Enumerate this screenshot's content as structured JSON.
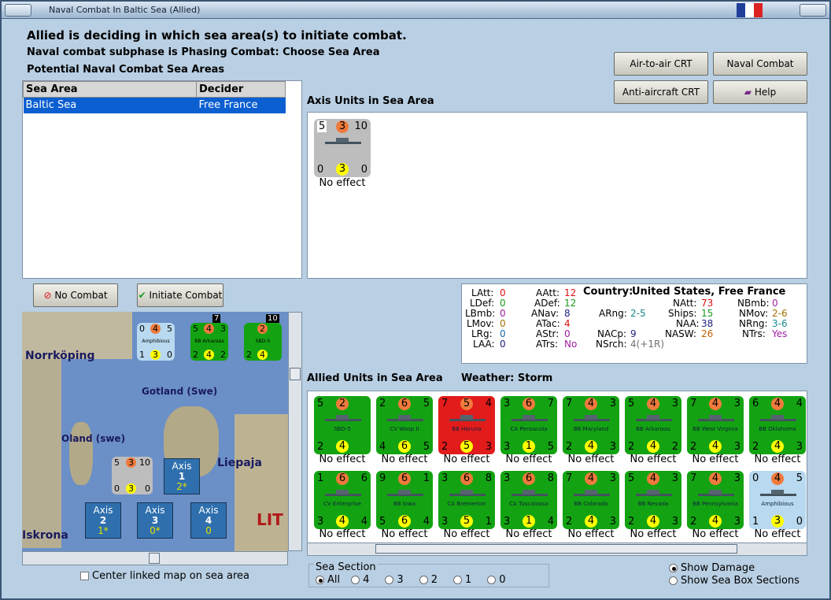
{
  "window": {
    "title": "Naval Combat In Baltic Sea (Allied)"
  },
  "header": {
    "line1": "Allied is deciding in which sea area(s) to initiate combat.",
    "line2": "Naval combat subphase is Phasing Combat: Choose Sea Area",
    "line3": "Potential Naval Combat Sea Areas"
  },
  "buttons": {
    "air_to_air": "Air-to-air CRT",
    "naval_chart": "Naval Combat Chart",
    "anti_aircraft": "Anti-aircraft CRT",
    "help": "Help",
    "no_combat": "No Combat",
    "initiate": "Initiate Combat"
  },
  "sea_table": {
    "headers": [
      "Sea Area",
      "Decider"
    ],
    "rows": [
      [
        "Baltic Sea",
        "Free France"
      ]
    ]
  },
  "axis_panel": {
    "title": "Axis Units in Sea Area",
    "unit": {
      "tl": "5",
      "tc": "3",
      "tr": "10",
      "bl": "0",
      "bc": "3",
      "br": "0",
      "effect": "No effect"
    }
  },
  "stats": {
    "latt_l": "LAtt:",
    "latt_v": "0",
    "ldef_l": "LDef:",
    "ldef_v": "0",
    "lbmb_l": "LBmb:",
    "lbmb_v": "0",
    "lmov_l": "LMov:",
    "lmov_v": "0",
    "lrg_l": "LRg:",
    "lrg_v": "0",
    "laa_l": "LAA:",
    "laa_v": "0",
    "aatt_l": "AAtt:",
    "aatt_v": "12",
    "adef_l": "ADef:",
    "adef_v": "12",
    "anav_l": "ANav:",
    "anav_v": "8",
    "atac_l": "ATac:",
    "atac_v": "4",
    "astr_l": "AStr:",
    "astr_v": "0",
    "atrs_l": "ATrs:",
    "atrs_v": "No",
    "country_l": "Country:",
    "country_v": "United States, Free France",
    "arng_l": "ARng:",
    "arng_v": "2-5",
    "nacp_l": "NACp:",
    "nacp_v": "9",
    "nsrch_l": "NSrch:",
    "nsrch_v": "4(+1R)",
    "natt_l": "NAtt:",
    "natt_v": "73",
    "ships_l": "Ships:",
    "ships_v": "15",
    "naa_l": "NAA:",
    "naa_v": "38",
    "nasw_l": "NASW:",
    "nasw_v": "26",
    "nbmb_l": "NBmb:",
    "nbmb_v": "0",
    "nmov_l": "NMov:",
    "nmov_v": "2-6",
    "nrng_l": "NRng:",
    "nrng_v": "3-6",
    "ntrs_l": "NTrs:",
    "ntrs_v": "Yes"
  },
  "allied_panel": {
    "title": "Allied Units in Sea Area",
    "weather": "Weather:  Storm",
    "units": [
      {
        "name": "SBD-5",
        "tl": "5",
        "tc": "2",
        "tr": "",
        "bl": "2",
        "bc": "4",
        "br": "",
        "color": "#13a312",
        "effect": "No effect"
      },
      {
        "name": "CV Wasp II",
        "tl": "2",
        "tc": "6",
        "tr": "5",
        "bl": "4",
        "bc": "6",
        "br": "5",
        "color": "#13a312",
        "effect": "No effect"
      },
      {
        "name": "BB Haruna",
        "tl": "7",
        "tc": "5",
        "tr": "4",
        "bl": "2",
        "bc": "5",
        "br": "3",
        "color": "#e21b1b",
        "effect": "No effect"
      },
      {
        "name": "CA Pensacola",
        "tl": "3",
        "tc": "6",
        "tr": "7",
        "bl": "3",
        "bc": "1",
        "br": "5",
        "color": "#13a312",
        "effect": "No effect"
      },
      {
        "name": "BB Maryland",
        "tl": "7",
        "tc": "4",
        "tr": "3",
        "bl": "2",
        "bc": "4",
        "br": "3",
        "color": "#13a312",
        "effect": "No effect"
      },
      {
        "name": "BB Arkansas",
        "tl": "5",
        "tc": "4",
        "tr": "3",
        "bl": "2",
        "bc": "4",
        "br": "2",
        "color": "#13a312",
        "effect": "No effect"
      },
      {
        "name": "BB West Virginia",
        "tl": "7",
        "tc": "4",
        "tr": "3",
        "bl": "2",
        "bc": "4",
        "br": "3",
        "color": "#13a312",
        "effect": "No effect"
      },
      {
        "name": "BB Oklahoma",
        "tl": "6",
        "tc": "4",
        "tr": "4",
        "bl": "2",
        "bc": "4",
        "br": "3",
        "color": "#13a312",
        "effect": "No effect"
      },
      {
        "name": "CV Enterprise",
        "tl": "1",
        "tc": "6",
        "tr": "6",
        "bl": "3",
        "bc": "4",
        "br": "4",
        "color": "#13a312",
        "effect": "No effect"
      },
      {
        "name": "BB Iowa",
        "tl": "9",
        "tc": "6",
        "tr": "1",
        "bl": "5",
        "bc": "6",
        "br": "4",
        "color": "#13a312",
        "effect": "No effect"
      },
      {
        "name": "CA Bremerton",
        "tl": "3",
        "tc": "6",
        "tr": "8",
        "bl": "3",
        "bc": "5",
        "br": "1",
        "color": "#13a312",
        "effect": "No effect"
      },
      {
        "name": "CA Tuscaloosa",
        "tl": "3",
        "tc": "6",
        "tr": "8",
        "bl": "3",
        "bc": "1",
        "br": "4",
        "color": "#13a312",
        "effect": "No effect"
      },
      {
        "name": "BB Colorado",
        "tl": "7",
        "tc": "4",
        "tr": "3",
        "bl": "2",
        "bc": "4",
        "br": "3",
        "color": "#13a312",
        "effect": "No effect"
      },
      {
        "name": "BB Nevada",
        "tl": "5",
        "tc": "4",
        "tr": "3",
        "bl": "2",
        "bc": "4",
        "br": "3",
        "color": "#13a312",
        "effect": "No effect"
      },
      {
        "name": "BB Pennsylvania",
        "tl": "7",
        "tc": "4",
        "tr": "3",
        "bl": "2",
        "bc": "4",
        "br": "3",
        "color": "#13a312",
        "effect": "No effect"
      },
      {
        "name": "Amphibious",
        "tl": "0",
        "tc": "4",
        "tr": "5",
        "bl": "1",
        "bc": "3",
        "br": "0",
        "color": "#b8d9ef",
        "effect": "No effect"
      }
    ]
  },
  "map": {
    "labels": {
      "norrkoping": "Norrköping",
      "gotland": "Gotland (Swe)",
      "oland": "Oland (swe)",
      "liepaja": "Liepaja",
      "iskrona": "Iskrona",
      "lit": "LIT"
    },
    "stack_top": [
      {
        "tl": "0",
        "tc": "4",
        "tr": "5",
        "bl": "1",
        "bc": "3",
        "br": "0",
        "name": "Amphibious",
        "color": "#b8d9ef",
        "count": ""
      },
      {
        "tl": "5",
        "tc": "4",
        "tr": "3",
        "bl": "2",
        "bc": "4",
        "br": "2",
        "name": "BB Arkansas",
        "color": "#13a312",
        "count": "7"
      },
      {
        "tl": "",
        "tc": "2",
        "tr": "",
        "bl": "2",
        "bc": "4",
        "br": "",
        "name": "SBD-5",
        "color": "#13a312",
        "count": "10"
      }
    ],
    "axis_counter": {
      "tl": "5",
      "tc": "3",
      "tr": "10",
      "bl": "0",
      "bc": "3",
      "br": "0"
    },
    "axis_boxes": [
      {
        "label": "Axis",
        "num": "1",
        "sub": "2*"
      },
      {
        "label": "Axis",
        "num": "2",
        "sub": "1*"
      },
      {
        "label": "Axis",
        "num": "3",
        "sub": "0*"
      },
      {
        "label": "Axis",
        "num": "4",
        "sub": "0"
      }
    ]
  },
  "bottom": {
    "center_label": "Center linked map on sea area",
    "sea_section": "Sea Section",
    "options": [
      "All",
      "4",
      "3",
      "2",
      "1",
      "0"
    ],
    "show_damage": "Show Damage",
    "show_sections": "Show Sea Box Sections"
  },
  "colors": {
    "accent": "#0c5fd0",
    "window_bg": "#b9cfe3"
  }
}
